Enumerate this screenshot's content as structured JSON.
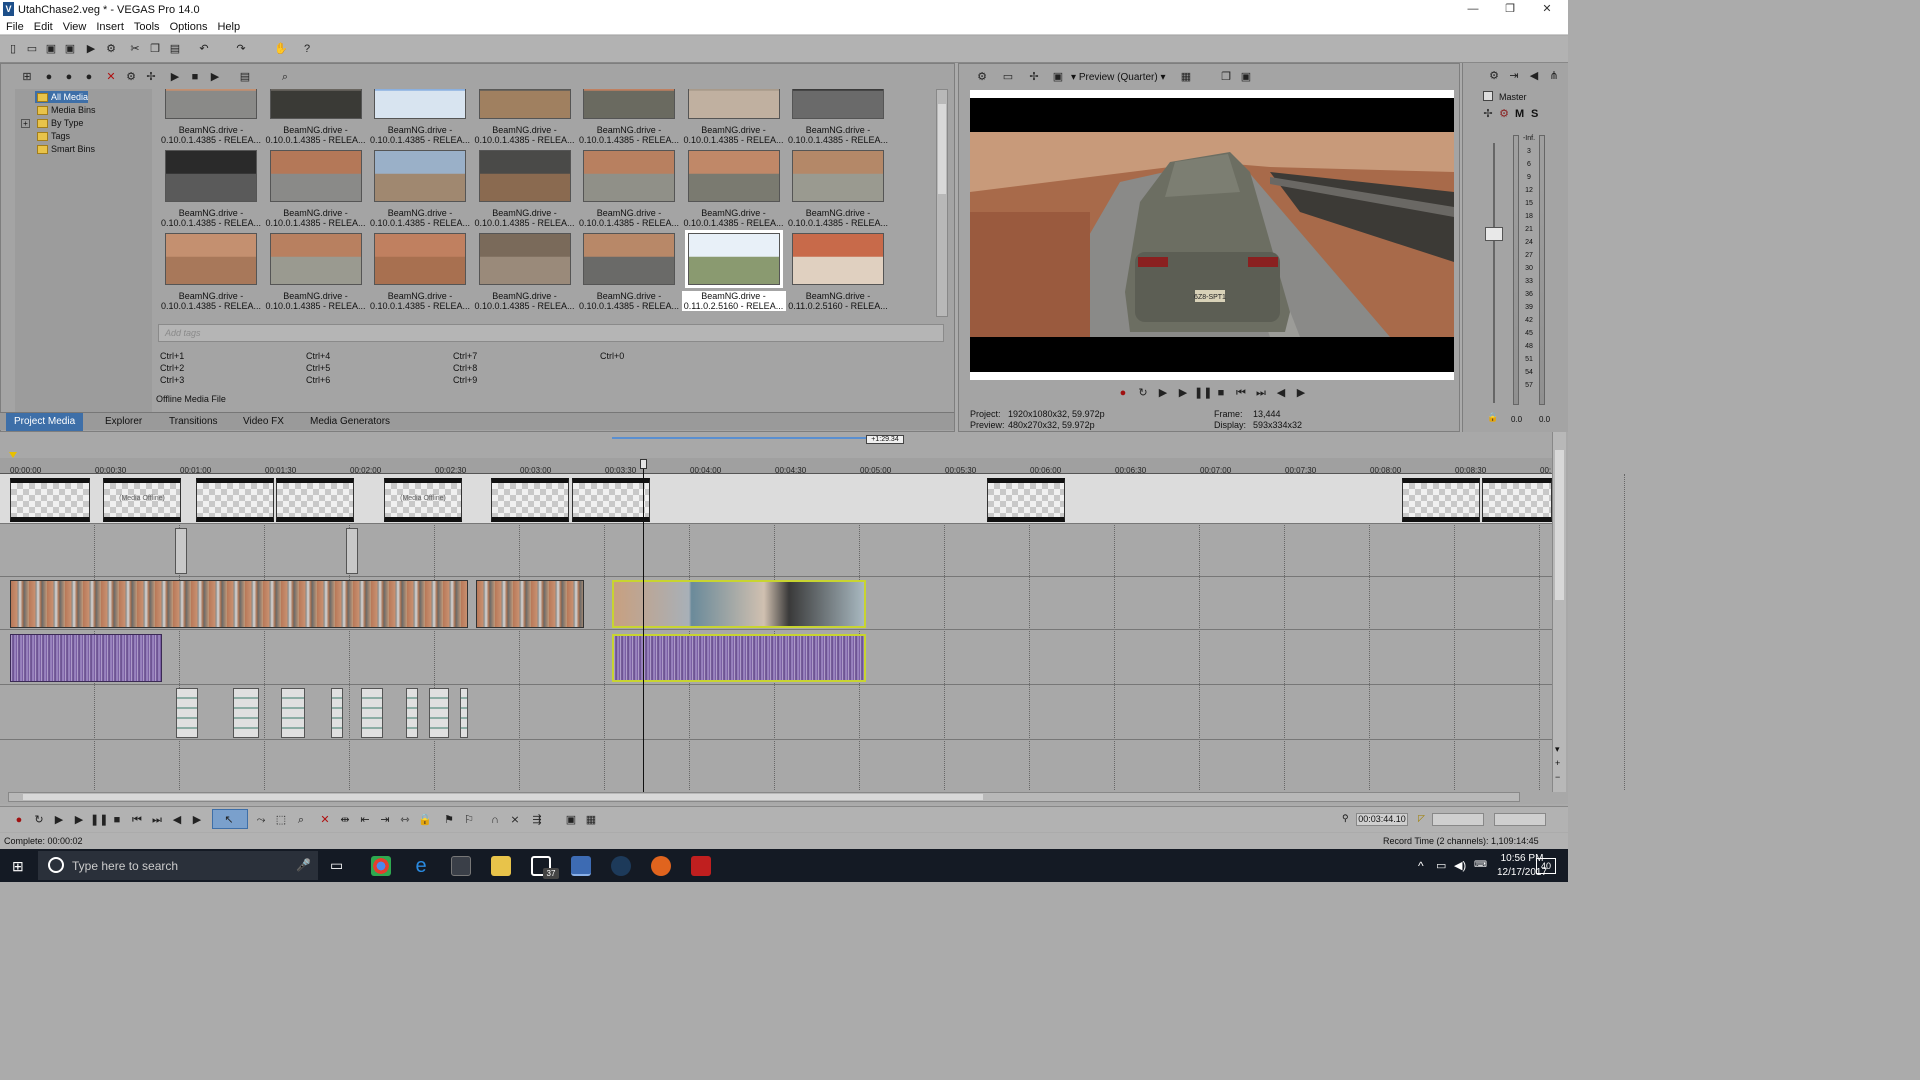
{
  "window": {
    "title": "UtahChase2.veg * - VEGAS Pro 14.0",
    "logo_letter": "V",
    "minimize": "—",
    "restore": "❐",
    "close": "✕"
  },
  "menu": [
    "File",
    "Edit",
    "View",
    "Insert",
    "Tools",
    "Options",
    "Help"
  ],
  "media_tree": {
    "items": [
      "All Media",
      "Media Bins",
      "By Type",
      "Tags",
      "Smart Bins"
    ],
    "expander": "+"
  },
  "media_grid": {
    "items": [
      {
        "line1": "BeamNG.drive -",
        "line2": "0.10.0.1.4385 - RELEA..."
      },
      {
        "line1": "BeamNG.drive -",
        "line2": "0.10.0.1.4385 - RELEA..."
      },
      {
        "line1": "BeamNG.drive -",
        "line2": "0.10.0.1.4385 - RELEA..."
      },
      {
        "line1": "BeamNG.drive -",
        "line2": "0.10.0.1.4385 - RELEA..."
      },
      {
        "line1": "BeamNG.drive -",
        "line2": "0.10.0.1.4385 - RELEA..."
      },
      {
        "line1": "BeamNG.drive -",
        "line2": "0.10.0.1.4385 - RELEA..."
      },
      {
        "line1": "BeamNG.drive -",
        "line2": "0.10.0.1.4385 - RELEA..."
      },
      {
        "line1": "BeamNG.drive -",
        "line2": "0.10.0.1.4385 - RELEA..."
      },
      {
        "line1": "BeamNG.drive -",
        "line2": "0.10.0.1.4385 - RELEA..."
      },
      {
        "line1": "BeamNG.drive -",
        "line2": "0.10.0.1.4385 - RELEA..."
      },
      {
        "line1": "BeamNG.drive -",
        "line2": "0.10.0.1.4385 - RELEA..."
      },
      {
        "line1": "BeamNG.drive -",
        "line2": "0.10.0.1.4385 - RELEA..."
      },
      {
        "line1": "BeamNG.drive -",
        "line2": "0.10.0.1.4385 - RELEA..."
      },
      {
        "line1": "BeamNG.drive -",
        "line2": "0.10.0.1.4385 - RELEA..."
      },
      {
        "line1": "BeamNG.drive -",
        "line2": "0.10.0.1.4385 - RELEA..."
      },
      {
        "line1": "BeamNG.drive -",
        "line2": "0.10.0.1.4385 - RELEA..."
      },
      {
        "line1": "BeamNG.drive -",
        "line2": "0.10.0.1.4385 - RELEA..."
      },
      {
        "line1": "BeamNG.drive -",
        "line2": "0.10.0.1.4385 - RELEA..."
      },
      {
        "line1": "BeamNG.drive -",
        "line2": "0.10.0.1.4385 - RELEA..."
      },
      {
        "line1": "BeamNG.drive -",
        "line2": "0.11.0.2.5160 - RELEA..."
      },
      {
        "line1": "BeamNG.drive -",
        "line2": "0.11.0.2.5160 - RELEA..."
      }
    ],
    "tags_placeholder": "Add tags",
    "shortcuts": [
      "Ctrl+1",
      "Ctrl+2",
      "Ctrl+3",
      "Ctrl+4",
      "Ctrl+5",
      "Ctrl+6",
      "Ctrl+7",
      "Ctrl+8",
      "Ctrl+9",
      "Ctrl+0"
    ],
    "status": "Offline Media File"
  },
  "tabs": [
    "Project Media",
    "Explorer",
    "Transitions",
    "Video FX",
    "Media Generators"
  ],
  "preview": {
    "mode": "Preview (Quarter)",
    "project_label": "Project:",
    "project_value": "1920x1080x32, 59.972p",
    "preview_label": "Preview:",
    "preview_value": "480x270x32, 59.972p",
    "frame_label": "Frame:",
    "frame_value": "13,444",
    "display_label": "Display:",
    "display_value": "593x334x32",
    "plate": "6Z8-SPT1"
  },
  "master": {
    "label": "Master",
    "m": "M",
    "s": "S",
    "scale": [
      "-Inf.",
      "3",
      "6",
      "9",
      "12",
      "15",
      "18",
      "21",
      "24",
      "27",
      "30",
      "33",
      "36",
      "39",
      "42",
      "45",
      "48",
      "51",
      "54",
      "57"
    ],
    "readout_left": "0.0",
    "readout_right": "0.0"
  },
  "timeline": {
    "loop_marker": "+1:29.34",
    "ruler": [
      "00:00:00",
      "00:00:30",
      "00:01:00",
      "00:01:30",
      "00:02:00",
      "00:02:30",
      "00:03:00",
      "00:03:30",
      "00:04:00",
      "00:04:30",
      "00:05:00",
      "00:05:30",
      "00:06:00",
      "00:06:30",
      "00:07:00",
      "00:07:30",
      "00:08:00",
      "00:08:30",
      "00:"
    ],
    "offline_label": "(Media Offline)",
    "cursor_time": "00:03:44.10"
  },
  "status": {
    "complete": "Complete: 00:00:02",
    "record_time": "Record Time (2 channels): 1,109:14:45"
  },
  "taskbar": {
    "search_placeholder": "Type here to search",
    "time": "10:56 PM",
    "date": "12/17/2017",
    "mail_badge": "37",
    "notif_badge": "40"
  },
  "colors": {
    "accent": "#3e6fa8",
    "audio": "#8466a8",
    "selection_outline": "#c8d430"
  }
}
